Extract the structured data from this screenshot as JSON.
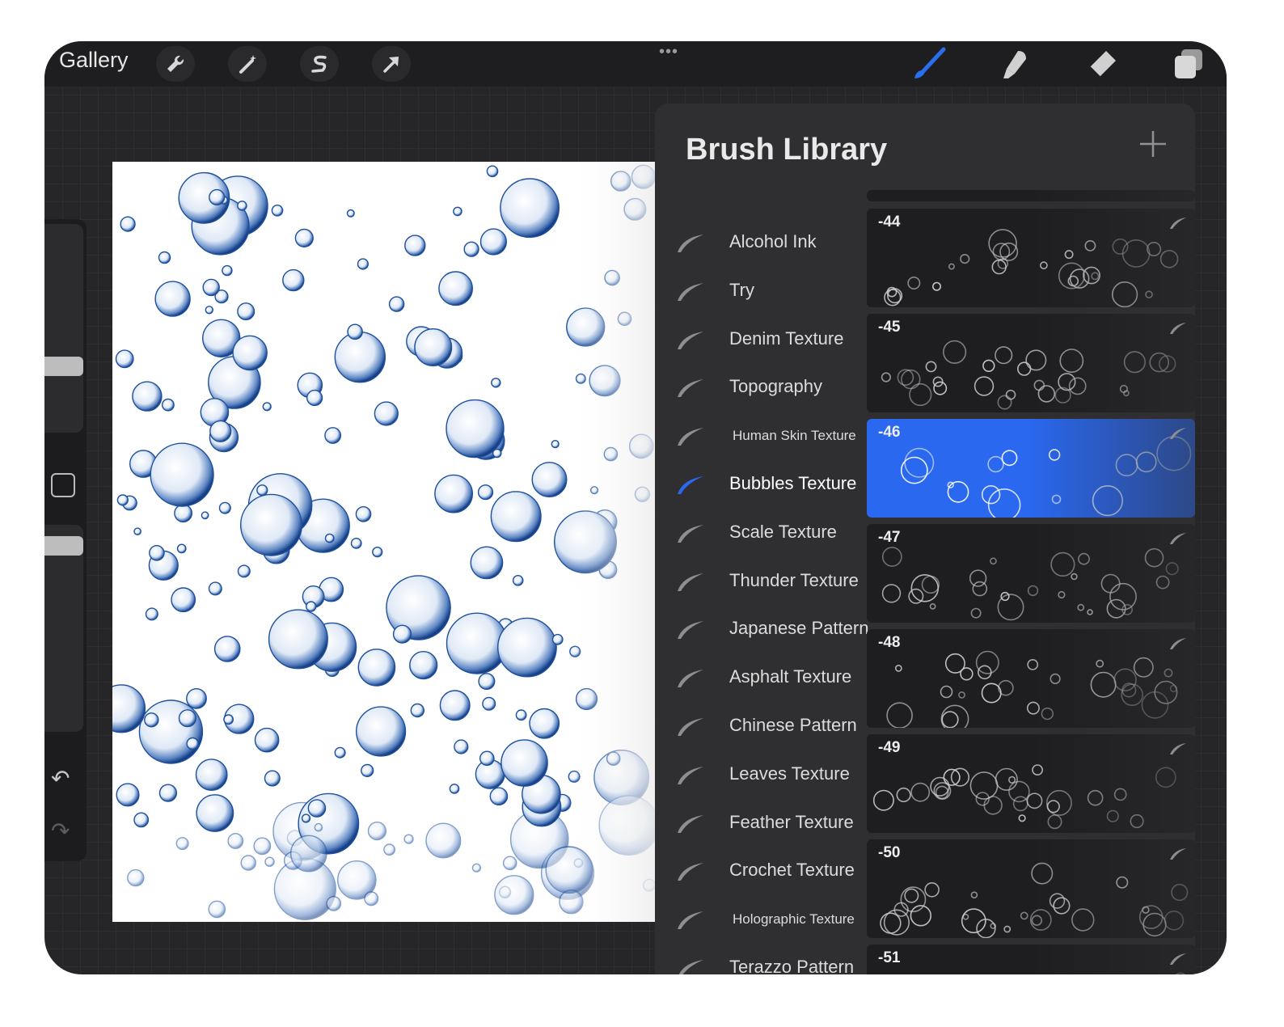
{
  "toolbar": {
    "gallery_label": "Gallery",
    "left_tools": [
      {
        "name": "actions-wrench-icon"
      },
      {
        "name": "adjustments-magic-wand-icon"
      },
      {
        "name": "selection-s-icon"
      },
      {
        "name": "transform-arrow-icon"
      }
    ],
    "right_tools": [
      {
        "name": "brush-icon",
        "active": true,
        "color": "#2a6ef0"
      },
      {
        "name": "smudge-icon"
      },
      {
        "name": "eraser-icon"
      },
      {
        "name": "layers-icon"
      }
    ],
    "grip_glyph": "•••"
  },
  "sidebar": {
    "undo_glyph": "↶",
    "redo_glyph": "↷"
  },
  "brush_library": {
    "title": "Brush Library",
    "add_glyph": "+",
    "categories": [
      {
        "label": "Alcohol Ink",
        "active": false,
        "small": false
      },
      {
        "label": "Try",
        "active": false,
        "small": false
      },
      {
        "label": "Denim Texture",
        "active": false,
        "small": false
      },
      {
        "label": "Topography",
        "active": false,
        "small": false
      },
      {
        "label": "Human Skin Texture",
        "active": false,
        "small": true
      },
      {
        "label": "Bubbles Texture",
        "active": true,
        "small": false
      },
      {
        "label": "Scale Texture",
        "active": false,
        "small": false
      },
      {
        "label": "Thunder Texture",
        "active": false,
        "small": false
      },
      {
        "label": "Japanese Pattern",
        "active": false,
        "small": false
      },
      {
        "label": "Asphalt Texture",
        "active": false,
        "small": false
      },
      {
        "label": "Chinese Pattern",
        "active": false,
        "small": false
      },
      {
        "label": "Leaves Texture",
        "active": false,
        "small": false
      },
      {
        "label": "Feather Texture",
        "active": false,
        "small": false
      },
      {
        "label": "Crochet Texture",
        "active": false,
        "small": false
      },
      {
        "label": "Holographic Texture",
        "active": false,
        "small": true
      },
      {
        "label": "Terazzo Pattern",
        "active": false,
        "small": false
      }
    ],
    "brushes": [
      {
        "name": "-44",
        "selected": false
      },
      {
        "name": "-45",
        "selected": false
      },
      {
        "name": "-46",
        "selected": true
      },
      {
        "name": "-47",
        "selected": false
      },
      {
        "name": "-48",
        "selected": false
      },
      {
        "name": "-49",
        "selected": false
      },
      {
        "name": "-50",
        "selected": false
      },
      {
        "name": "-51",
        "selected": false
      }
    ]
  },
  "colors": {
    "accent_blue": "#2a68f0",
    "bubble_blue": "#1d4f9c"
  }
}
